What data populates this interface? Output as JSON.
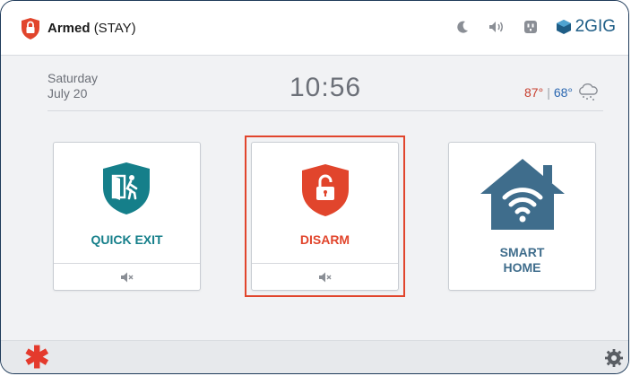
{
  "colors": {
    "accent_red": "#e1452c",
    "teal": "#157f8a",
    "house_blue": "#3f6d8c",
    "temp_high": "#c8402f",
    "temp_low": "#2b67b0"
  },
  "header": {
    "status_bold": "Armed",
    "status_mode": "(STAY)",
    "icons": [
      "lock-shield-icon",
      "moon-icon",
      "speaker-icon",
      "outlet-icon",
      "brand-logo-icon"
    ],
    "brand": "2GIG"
  },
  "info": {
    "day": "Saturday",
    "date": "July 20",
    "time": "10:56",
    "temp_high": "87°",
    "temp_sep": "|",
    "temp_low": "68°",
    "weather_icon": "cloud-snow-icon"
  },
  "tiles": [
    {
      "label": "QUICK EXIT",
      "icon": "exit-shield-icon",
      "footer_icon": "mute-icon"
    },
    {
      "label": "DISARM",
      "icon": "unlock-shield-icon",
      "footer_icon": "mute-icon"
    },
    {
      "label_line1": "SMART",
      "label_line2": "HOME",
      "icon": "smart-home-icon"
    }
  ],
  "footer": {
    "left_icon": "asterisk-icon",
    "right_icon": "gear-icon"
  }
}
